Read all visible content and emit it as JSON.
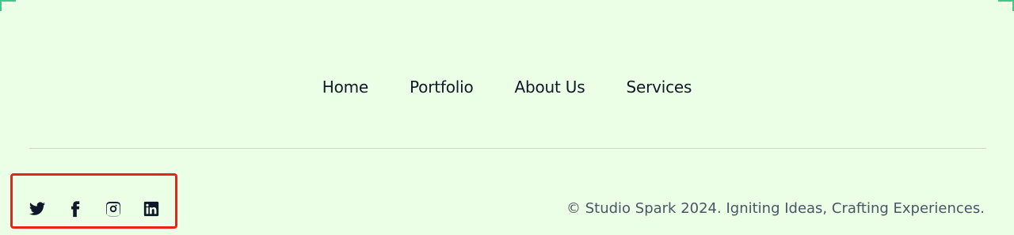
{
  "nav": {
    "items": [
      {
        "label": "Home"
      },
      {
        "label": "Portfolio"
      },
      {
        "label": "About Us"
      },
      {
        "label": "Services"
      }
    ]
  },
  "social": {
    "icons": [
      "twitter-icon",
      "facebook-icon",
      "instagram-icon",
      "linkedin-icon"
    ]
  },
  "footer": {
    "copyright": "© Studio Spark 2024. Igniting Ideas, Crafting Experiences."
  },
  "colors": {
    "background": "#eaffe6",
    "text": "#0f172a",
    "highlight_border": "#e3261b",
    "divider": "#cdd9cb",
    "corner_accent": "#40c98a"
  }
}
